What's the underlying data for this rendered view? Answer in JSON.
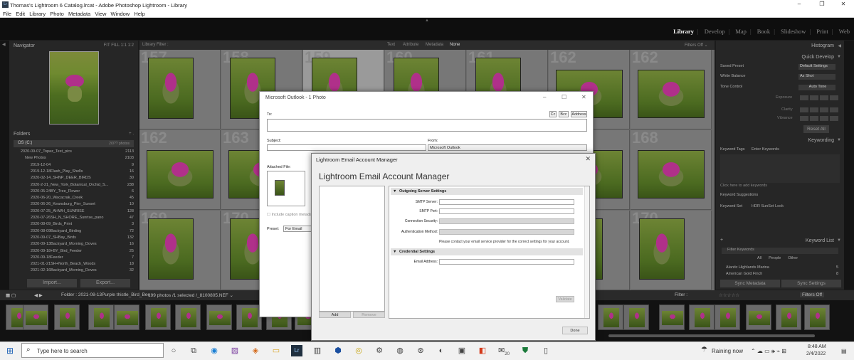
{
  "window": {
    "title": "Thomas's Lightroom 6 Catalog.lrcat - Adobe Photoshop Lightroom - Library",
    "app_icon": "Lr",
    "minimize": "–",
    "maximize": "❐",
    "close": "✕"
  },
  "menu": [
    "File",
    "Edit",
    "Library",
    "Photo",
    "Metadata",
    "View",
    "Window",
    "Help"
  ],
  "modules": [
    "Library",
    "Develop",
    "Map",
    "Book",
    "Slideshow",
    "Print",
    "Web"
  ],
  "active_module": "Library",
  "navigator": {
    "title": "Navigator",
    "zoom_options": "FIT  FILL  1:1  1:2"
  },
  "folders": {
    "title": "Folders",
    "actions": "+ .",
    "volume_name": "OS (C:)",
    "volume_info": "2/0?? photos",
    "items": [
      {
        "name": "2020-09-07_Topaz_Test_pics",
        "count": "2113",
        "level": "top"
      },
      {
        "name": "New Photos",
        "count": "2103",
        "level": "sub"
      },
      {
        "name": "2019-12-04",
        "count": "9",
        "level": "leaf"
      },
      {
        "name": "2019-12-18Flash_Play_Shells",
        "count": "16",
        "level": "leaf"
      },
      {
        "name": "2020-02-14_SHNP_DEER_BIRDS",
        "count": "30",
        "level": "leaf"
      },
      {
        "name": "2020-2-21_New_York_Botanical_Orchid_S...",
        "count": "238",
        "level": "leaf"
      },
      {
        "name": "2020-05-24BY_Tree_Flower",
        "count": "6",
        "level": "leaf"
      },
      {
        "name": "2020-06-20_Wacacrak_Creek",
        "count": "45",
        "level": "leaf"
      },
      {
        "name": "2020-06-26_Keansburg_Pier_Sunset",
        "count": "10",
        "level": "leaf"
      },
      {
        "name": "2020-07-25_AHWH_SUNRISE",
        "count": "128",
        "level": "leaf"
      },
      {
        "name": "2020-07-26SH_N_SHORE_Sunrise_pano",
        "count": "47",
        "level": "leaf"
      },
      {
        "name": "2020-08-09_Birds_Print",
        "count": "3",
        "level": "leaf"
      },
      {
        "name": "2020-08-09Backyard_Birding",
        "count": "72",
        "level": "leaf"
      },
      {
        "name": "2020-09-07_SHBay_Birds",
        "count": "132",
        "level": "leaf"
      },
      {
        "name": "2020-09-13Backyard_Morning_Doves",
        "count": "16",
        "level": "leaf"
      },
      {
        "name": "2020-09-18+BY_Bird_Feeder",
        "count": "25",
        "level": "leaf"
      },
      {
        "name": "2020-09-18Feeder",
        "count": "7",
        "level": "leaf"
      },
      {
        "name": "2021-01-21SH+North_Beach_Woods",
        "count": "18",
        "level": "leaf"
      },
      {
        "name": "2021-02-16Backyard_Morning_Doves",
        "count": "32",
        "level": "leaf"
      }
    ],
    "import_label": "Import...",
    "export_label": "Export..."
  },
  "library_filter": {
    "label": "Library Filter :",
    "options": [
      "Text",
      "Attribute",
      "Metadata",
      "None"
    ],
    "active": "None",
    "filters_off": "Filters Off ⌄"
  },
  "grid": {
    "rows": [
      [
        "157",
        "158",
        "159",
        "160",
        "161",
        "162",
        "167"
      ],
      [
        "162",
        "163",
        "164",
        "165",
        "166",
        "167",
        "168"
      ],
      [
        "169",
        "170",
        "171",
        "172",
        "173",
        "174",
        "175"
      ]
    ],
    "visible_numbers": [
      "157",
      "158",
      "159",
      "160",
      "161",
      "162",
      "163",
      "168",
      "169",
      "170"
    ]
  },
  "right_panel": {
    "histogram": "Histogram",
    "quick_develop": "Quick Develop",
    "saved_preset_label": "Saved Preset",
    "saved_preset_value": "Default Settings",
    "white_balance_label": "White Balance",
    "white_balance_value": "As Shot",
    "tone_control_label": "Tone Control",
    "auto_tone": "Auto Tone",
    "exposure": "Exposure",
    "clarity": "Clarity",
    "vibrance": "Vibrance",
    "reset_all": "Reset All",
    "keywording": "Keywording",
    "keyword_tags_label": "Keyword Tags",
    "keyword_tags_value": "Enter Keywords",
    "add_keywords_hint": "Click here to add keywords",
    "keyword_suggestions": "Keyword Suggestions",
    "keyword_set_label": "Keyword Set",
    "keyword_set_value": "HDR SunSet Look",
    "keyword_list": "Keyword List",
    "filter_keywords": "Filter Keywords",
    "tabs": [
      "All",
      "People",
      "Other"
    ],
    "keywords": [
      "Alantic Highlands Marina",
      "American Gold Finch"
    ],
    "keyword_counts": [
      "5",
      "8"
    ],
    "sync_metadata": "Sync Metadata",
    "sync_settings": "Sync Settings"
  },
  "toolbar": {
    "breadcrumb": "Folder : 2021-08-13Purple thistle_Bird_Bee",
    "count": "199 photos /1 selected /_8100805.NEF ⌄",
    "filter_label": "Filter :",
    "filters_off": "Filters Off"
  },
  "filmstrip": {
    "thumb_count": 28
  },
  "outlook": {
    "title": "Microsoft Outlook - 1 Photo",
    "to_label": "To:",
    "cc": "Cc",
    "bcc": "Bcc",
    "address": "Address",
    "subject_label": "Subject:",
    "from_label": "From:",
    "from_value": "Microsoft Outlook",
    "attached_label": "Attached File:",
    "caption_label": "Include caption metadata",
    "preset_label": "Preset:",
    "preset_value": "For Email"
  },
  "email_manager": {
    "window_title": "Lightroom Email Account Manager",
    "heading": "Lightroom Email Account Manager",
    "add_label": "Add",
    "remove_label": "Remove",
    "outgoing_section": "Outgoing Server Settings",
    "smtp_server_label": "SMTP Server:",
    "smtp_port_label": "SMTP Port:",
    "connection_security_label": "Connection Security:",
    "auth_method_label": "Authentication Method:",
    "note": "Please contact your email service provider for the correct settings for your account.",
    "credential_section": "Credential Settings",
    "email_address_label": "Email Address:",
    "validate_label": "Validate",
    "done_label": "Done"
  },
  "taskbar": {
    "search_placeholder": "Type here to search",
    "weather": "Raining now",
    "time": "8:48 AM",
    "date": "2/4/2022",
    "mail_badge": "20"
  }
}
